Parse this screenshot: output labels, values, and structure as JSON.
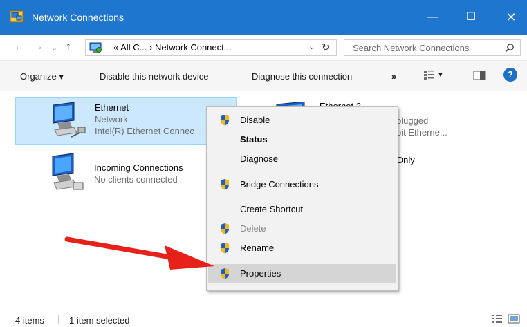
{
  "window": {
    "title": "Network Connections",
    "minimize": "—",
    "maximize": "☐",
    "close": "✕"
  },
  "address": {
    "back": "←",
    "forward": "→",
    "recent": "⌄",
    "up": "↑",
    "prefix": "«",
    "crumb1": "All C...",
    "sep": "›",
    "crumb2": "Network Connect...",
    "dropdown": "⌄",
    "refresh": "↻"
  },
  "search": {
    "placeholder": "Search Network Connections"
  },
  "toolbar": {
    "organize": "Organize ▾",
    "disable": "Disable this network device",
    "diagnose": "Diagnose this connection",
    "more": "»",
    "view_dropdown": "▼",
    "help": "?"
  },
  "items": [
    {
      "name": "Ethernet",
      "line2": "Network",
      "line3": "Intel(R) Ethernet Connec",
      "selected": true
    },
    {
      "name": "Ethernet 2",
      "line2": "plugged",
      "line3": "bit Etherne..."
    },
    {
      "name": "Incoming Connections",
      "line2": "No clients connected",
      "line3": ""
    },
    {
      "name": "",
      "line2": "Only",
      "line3": ""
    }
  ],
  "context_menu": {
    "items": [
      {
        "label": "Disable",
        "shield": true
      },
      {
        "label": "Status",
        "bold": true
      },
      {
        "label": "Diagnose"
      },
      {
        "label": "Bridge Connections",
        "shield": true
      },
      {
        "label": "Create Shortcut"
      },
      {
        "label": "Delete",
        "shield": true,
        "disabled": true
      },
      {
        "label": "Rename",
        "shield": true
      },
      {
        "label": "Properties",
        "shield": true,
        "highlighted": true
      }
    ]
  },
  "status": {
    "count": "4 items",
    "selection": "1 item selected"
  },
  "colors": {
    "titlebar": "#1f76cf",
    "selection": "#cce8ff",
    "arrow": "#e8201a",
    "shield_blue": "#1f5fbf",
    "shield_yellow": "#f3b91b"
  }
}
